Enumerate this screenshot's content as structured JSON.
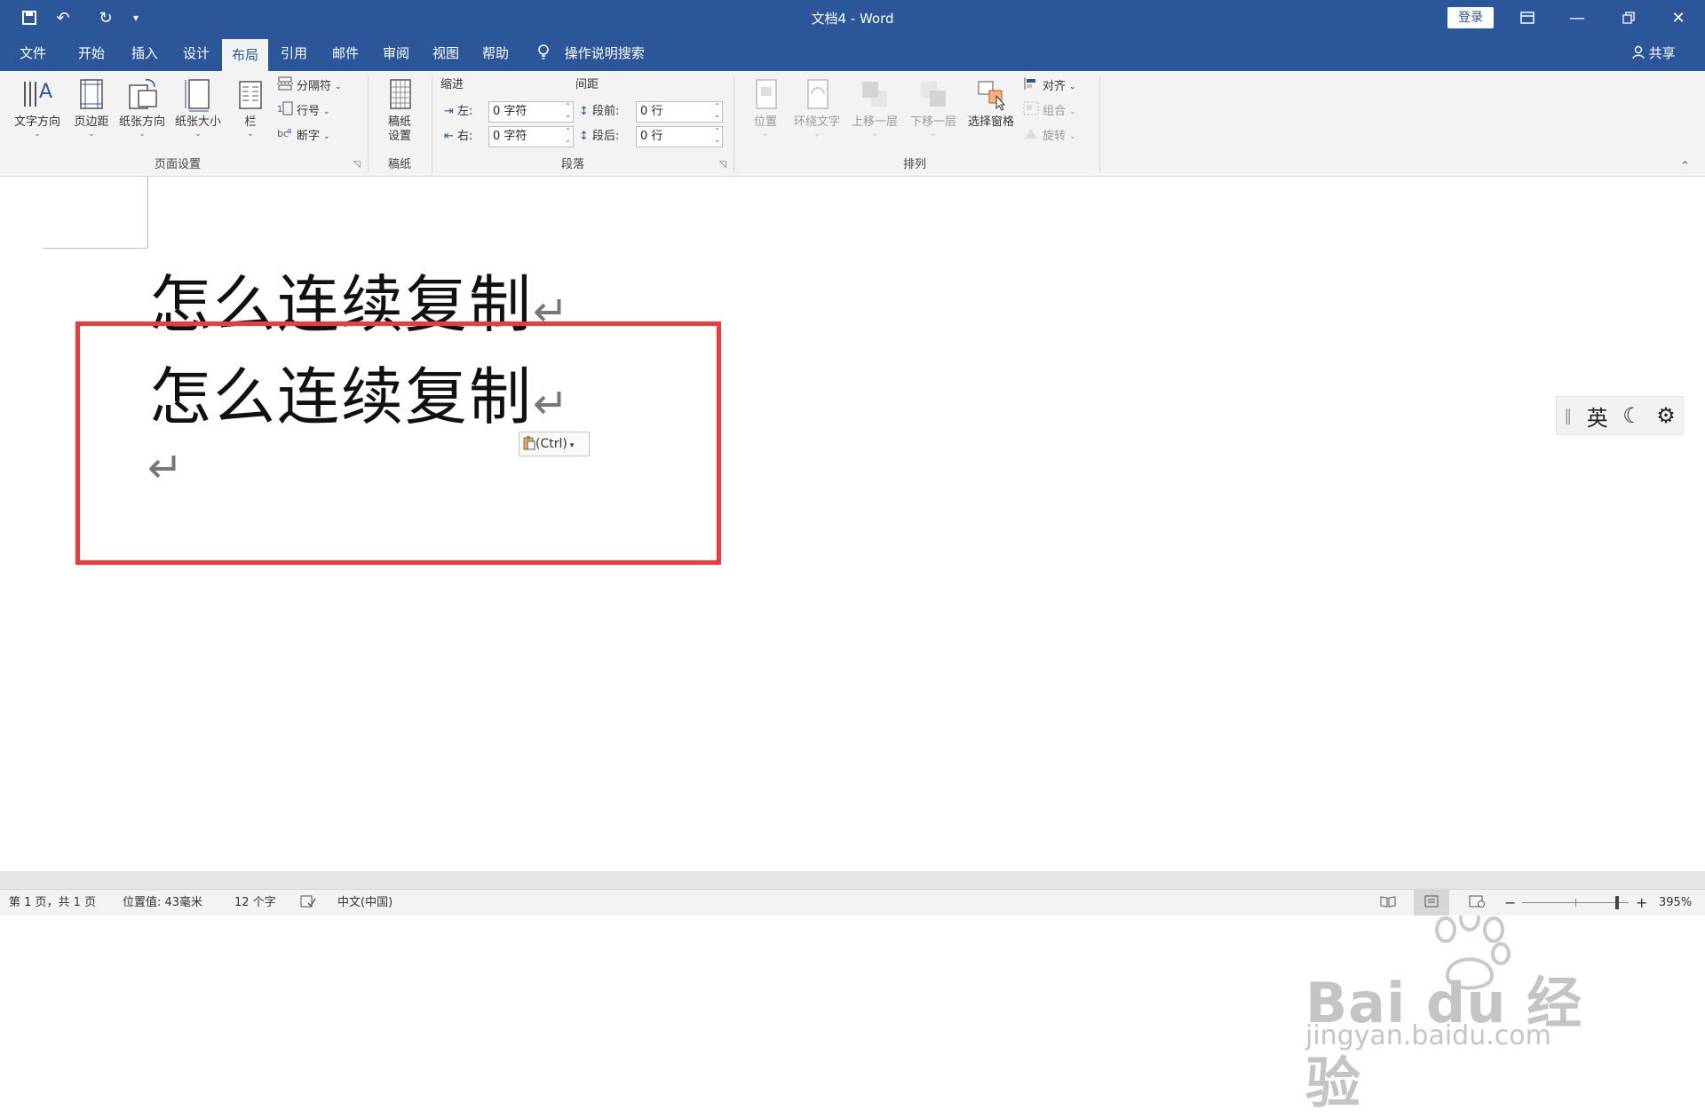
{
  "window": {
    "title": "文档4  -  Word",
    "login_label": "登录",
    "qat": {
      "save_icon": "save-icon",
      "undo_icon": "undo-icon",
      "redo_icon": "redo-icon",
      "customize_icon": "customize-icon"
    }
  },
  "tabs": [
    {
      "label": "文件"
    },
    {
      "label": "开始"
    },
    {
      "label": "插入"
    },
    {
      "label": "设计"
    },
    {
      "label": "布局",
      "active": true
    },
    {
      "label": "引用"
    },
    {
      "label": "邮件"
    },
    {
      "label": "审阅"
    },
    {
      "label": "视图"
    },
    {
      "label": "帮助"
    }
  ],
  "tell_me": "操作说明搜索",
  "share": "共享",
  "ribbon": {
    "page_setup": {
      "label": "页面设置",
      "text_direction": "文字方向",
      "margins": "页边距",
      "orientation": "纸张方向",
      "size": "纸张大小",
      "columns": "栏",
      "breaks": "分隔符",
      "line_numbers": "行号",
      "hyphenation": "断字"
    },
    "manuscript": {
      "label": "稿纸",
      "setup_line1": "稿纸",
      "setup_line2": "设置"
    },
    "paragraph": {
      "label": "段落",
      "indent": "缩进",
      "spacing": "间距",
      "left_label": "左:",
      "left_value": "0 字符",
      "right_label": "右:",
      "right_value": "0 字符",
      "before_label": "段前:",
      "before_value": "0 行",
      "after_label": "段后:",
      "after_value": "0 行"
    },
    "arrange": {
      "label": "排列",
      "position": "位置",
      "wrap": "环绕文字",
      "bring_forward": "上移一层",
      "send_backward": "下移一层",
      "selection_pane": "选择窗格",
      "align": "对齐",
      "group": "组合",
      "rotate": "旋转"
    }
  },
  "document": {
    "line1": "怎么连续复制",
    "line2": "怎么连续复制",
    "paragraph_mark": "↵",
    "paste_options": "(Ctrl)"
  },
  "ime": {
    "lang": "英"
  },
  "status": {
    "page": "第 1 页，共 1 页",
    "position": "位置值: 43毫米",
    "words": "12 个字",
    "language": "中文(中国)",
    "zoom": "395%"
  },
  "watermark": {
    "text": "Bai du 经验",
    "url": "jingyan.baidu.com"
  }
}
